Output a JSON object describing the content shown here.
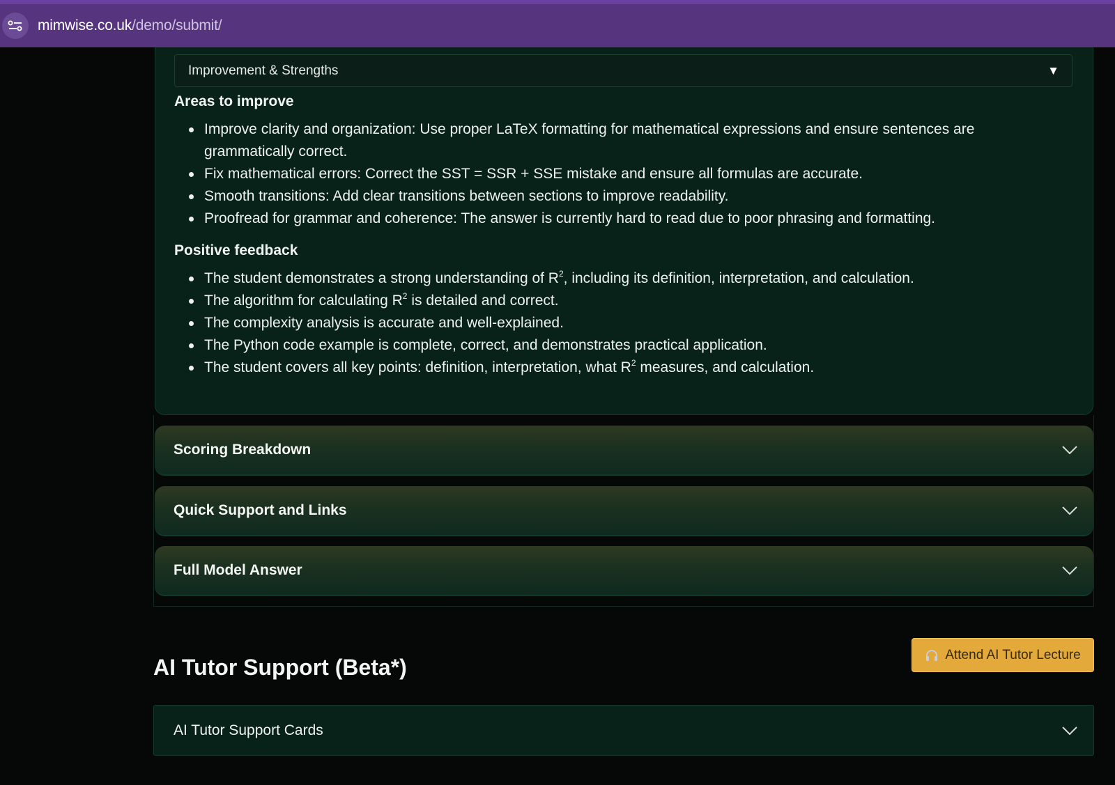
{
  "browser": {
    "url_host": "mimwise.co.uk",
    "url_path": "/demo/submit/"
  },
  "feedback": {
    "dropdown_label": "Improvement & Strengths",
    "areas_heading": "Areas to improve",
    "areas": [
      "Improve clarity and organization: Use proper LaTeX formatting for mathematical expressions and ensure sentences are grammatically correct.",
      "Fix mathematical errors: Correct the SST = SSR + SSE mistake and ensure all formulas are accurate.",
      "Smooth transitions: Add clear transitions between sections to improve readability.",
      "Proofread for grammar and coherence: The answer is currently hard to read due to poor phrasing and formatting."
    ],
    "positive_heading": "Positive feedback",
    "positive": [
      {
        "before": "The student demonstrates a strong understanding of R",
        "sup": "2",
        "after": ", including its definition, interpretation, and calculation."
      },
      {
        "before": "The algorithm for calculating R",
        "sup": "2",
        "after": " is detailed and correct."
      },
      {
        "before": "The complexity analysis is accurate and well-explained.",
        "sup": "",
        "after": ""
      },
      {
        "before": "The Python code example is complete, correct, and demonstrates practical application.",
        "sup": "",
        "after": ""
      },
      {
        "before": "The student covers all key points: definition, interpretation, what R",
        "sup": "2",
        "after": " measures, and calculation."
      }
    ]
  },
  "accordions": [
    {
      "title": "Scoring Breakdown"
    },
    {
      "title": "Quick Support and Links"
    },
    {
      "title": "Full Model Answer"
    }
  ],
  "ai_tutor": {
    "heading": "AI Tutor Support (Beta*)",
    "lecture_button": "Attend AI Tutor Lecture",
    "cards_title": "AI Tutor Support Cards"
  },
  "icons": {
    "site_info": "tune-icon",
    "dropdown_caret": "caret-down-icon",
    "chevron": "chevron-down-icon",
    "lecture": "headphones-icon"
  },
  "colors": {
    "browser_bar": "#57357e",
    "panel": "#082219",
    "accent_button": "#e3a93a"
  }
}
